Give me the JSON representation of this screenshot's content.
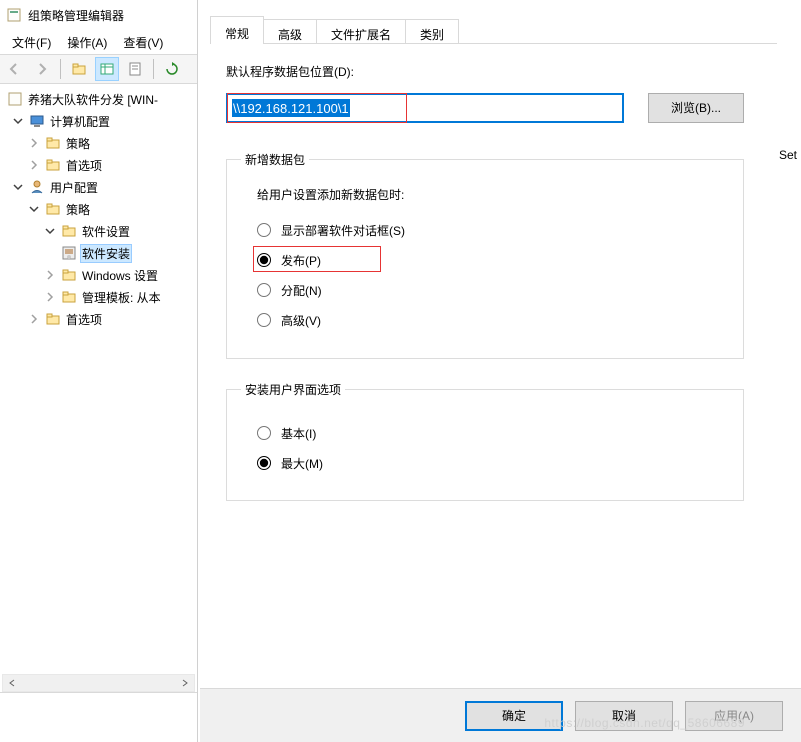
{
  "editor": {
    "title": "组策略管理编辑器",
    "menu": {
      "file": "文件(F)",
      "action": "操作(A)",
      "view": "查看(V)"
    },
    "tree": {
      "root": "养猪大队软件分发 [WIN-",
      "computer_config": "计算机配置",
      "cc_policies": "策略",
      "cc_prefs": "首选项",
      "user_config": "用户配置",
      "uc_policies": "策略",
      "sw_settings": "软件设置",
      "sw_install": "软件安装",
      "win_settings": "Windows 设置",
      "admin_templates": "管理模板: 从本",
      "uc_prefs": "首选项"
    }
  },
  "background": {
    "set_label": "Set"
  },
  "dialog": {
    "tabs": {
      "general": "常规",
      "advanced": "高级",
      "file_ext": "文件扩展名",
      "categories": "类别"
    },
    "path_label": "默认程序数据包位置(D):",
    "path_value": "\\\\192.168.121.100\\1",
    "browse": "浏览(B)...",
    "group_new": {
      "legend": "新增数据包",
      "intro": "给用户设置添加新数据包时:",
      "opt_show": "显示部署软件对话框(S)",
      "opt_publish": "发布(P)",
      "opt_assign": "分配(N)",
      "opt_advanced": "高级(V)"
    },
    "group_install_ui": {
      "legend": "安装用户界面选项",
      "opt_basic": "基本(I)",
      "opt_max": "最大(M)"
    },
    "buttons": {
      "ok": "确定",
      "cancel": "取消",
      "apply": "应用(A)"
    }
  },
  "watermark": "https://blog.csdn.net/qq_58606689"
}
